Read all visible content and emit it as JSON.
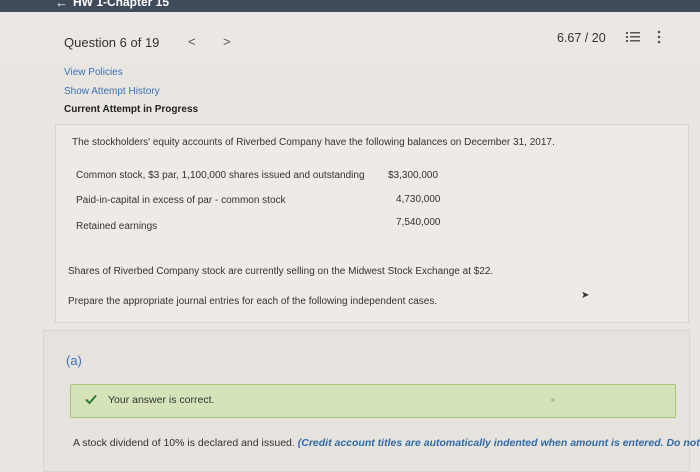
{
  "topbar": {
    "back_glyph": "←",
    "title": "HW 1-Chapter 15"
  },
  "header": {
    "question_label": "Question 6 of 19",
    "prev_glyph": "<",
    "next_glyph": ">",
    "score": "6.67 / 20",
    "icons": [
      "list-icon",
      "more-icon"
    ]
  },
  "links": {
    "view_policies": "View Policies",
    "show_attempt_history": "Show Attempt History",
    "current_attempt": "Current Attempt in Progress"
  },
  "question": {
    "intro": "The stockholders' equity accounts of Riverbed Company have the following balances on December 31, 2017.",
    "accounts": [
      {
        "label": "Common stock, $3 par, 1,100,000 shares issued and outstanding",
        "value": "$3,300,000"
      },
      {
        "label": "Paid-in-capital in excess of par - common stock",
        "value": "4,730,000"
      },
      {
        "label": "Retained earnings",
        "value": "7,540,000"
      }
    ],
    "shares_text": "Shares of Riverbed Company stock are currently selling on the Midwest Stock Exchange at $22.",
    "prepare_text": "Prepare the appropriate journal entries for each of the following independent cases."
  },
  "part_a": {
    "label": "(a)",
    "correct_message": "Your answer is correct.",
    "instruction_start": "A stock dividend of 10% is declared and issued.",
    "instruction_hint": "(Credit account titles are automatically indented when amount is entered. Do not indent"
  },
  "colors": {
    "accent": "#3b73b9",
    "success_bg": "#d4e3b8",
    "success_border": "#a7c47a",
    "check": "#2e7d32"
  }
}
